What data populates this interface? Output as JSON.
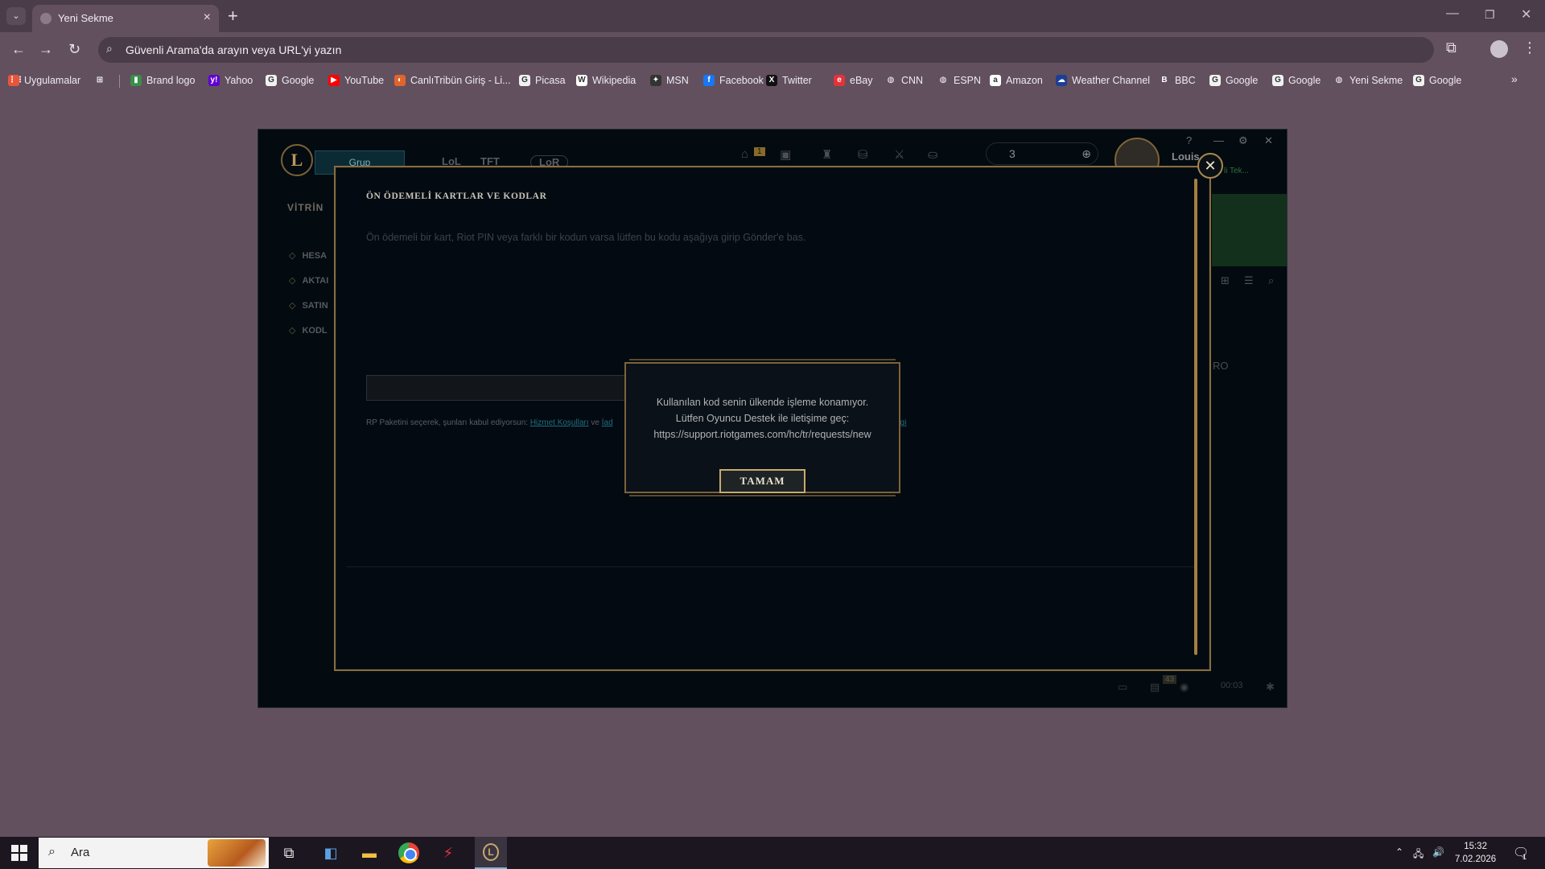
{
  "browser": {
    "tab_title": "Yeni Sekme",
    "omnibox_placeholder": "Güvenli Arama'da arayın veya URL'yi yazın",
    "bookmarks": [
      {
        "label": "Uygulamalar",
        "icon": "apps-grid-icon",
        "color": "#e8553a"
      },
      {
        "label": "",
        "icon": "tab-groups-icon",
        "color": "#62505f"
      },
      {
        "label": "Brand logo",
        "icon": "brand-logo-icon",
        "color": "#3a8f4a"
      },
      {
        "label": "Yahoo",
        "icon": "yahoo-icon",
        "color": "#6001d2"
      },
      {
        "label": "Google",
        "icon": "google-icon",
        "color": "#f1f1f1"
      },
      {
        "label": "YouTube",
        "icon": "youtube-icon",
        "color": "#ff0000"
      },
      {
        "label": "CanlıTribün Giriş - Li...",
        "icon": "canlitribun-icon",
        "color": "#e0652b"
      },
      {
        "label": "Picasa",
        "icon": "google-icon",
        "color": "#f1f1f1"
      },
      {
        "label": "Wikipedia",
        "icon": "wikipedia-icon",
        "color": "#ffffff"
      },
      {
        "label": "MSN",
        "icon": "msn-icon",
        "color": "#333333"
      },
      {
        "label": "Facebook",
        "icon": "facebook-icon",
        "color": "#1877f2"
      },
      {
        "label": "Twitter",
        "icon": "x-twitter-icon",
        "color": "#111111"
      },
      {
        "label": "eBay",
        "icon": "ebay-icon",
        "color": "#e53238"
      },
      {
        "label": "CNN",
        "icon": "globe-icon",
        "color": "#62505f"
      },
      {
        "label": "ESPN",
        "icon": "globe-icon",
        "color": "#62505f"
      },
      {
        "label": "Amazon",
        "icon": "amazon-icon",
        "color": "#ffffff"
      },
      {
        "label": "Weather Channel",
        "icon": "weather-channel-icon",
        "color": "#1c3f94"
      },
      {
        "label": "BBC",
        "icon": "bbc-icon",
        "color": "#62505f"
      },
      {
        "label": "Google",
        "icon": "google-icon",
        "color": "#f1f1f1"
      },
      {
        "label": "Google",
        "icon": "google-icon",
        "color": "#f1f1f1"
      },
      {
        "label": "Yeni Sekme",
        "icon": "globe-icon",
        "color": "#62505f"
      },
      {
        "label": "Google",
        "icon": "google-icon",
        "color": "#f1f1f1"
      }
    ]
  },
  "client": {
    "play_button": "Grup",
    "nav": [
      "LoL",
      "TFT",
      "LoR"
    ],
    "notification_count": "1",
    "rp_amount": "3",
    "username": "Louis",
    "status": "li Tek...",
    "store_tab": "VİTRİN",
    "side_items": [
      "HESA",
      "AKTAI",
      "SATIN",
      "KODL"
    ],
    "right_text": "RO",
    "bottom_count": "43",
    "bottom_time": "00:03"
  },
  "store_dialog": {
    "title": "ÖN ÖDEMELİ KARTLAR VE KODLAR",
    "description": "Ön ödemeli bir kart, Riot PIN veya farklı bir kodun varsa lütfen bu kodu aşağıya girip Gönder'e bas.",
    "terms_prefix": "RP Paketini seçerek, şunları kabul ediyorsun:",
    "terms_link": "Hizmet Koşulları",
    "terms_and": "ve",
    "terms_link2": "İad",
    "terms_link3": "ık Bilgi"
  },
  "error_modal": {
    "lines": [
      "Kullanılan kod senin ülkende işleme konamıyor.",
      "Lütfen Oyuncu Destek ile iletişime geç:",
      "https://support.riotgames.com/hc/tr/requests/new"
    ],
    "ok_label": "TAMAM"
  },
  "taskbar": {
    "search_placeholder": "Ara",
    "time": "15:32",
    "date": "7.02.2026",
    "notification_badge": "1"
  }
}
